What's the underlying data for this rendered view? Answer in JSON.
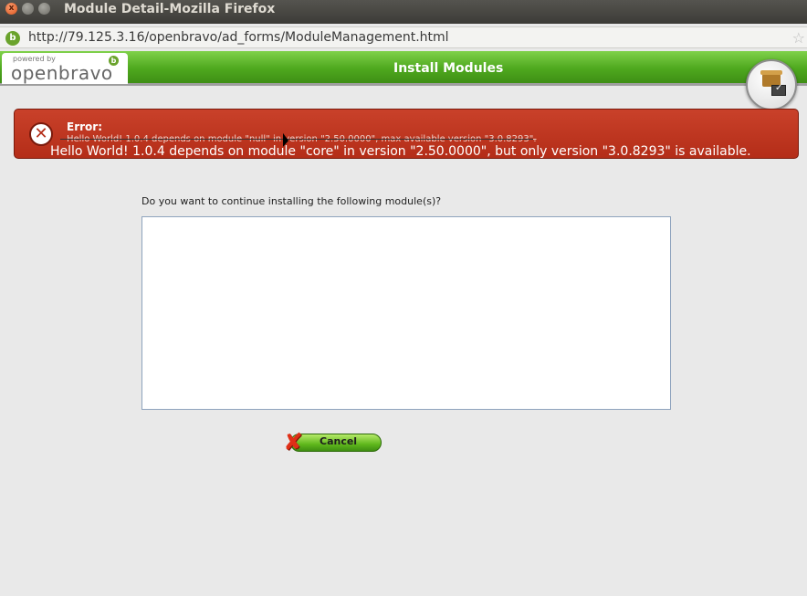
{
  "window": {
    "title": "Module Detail-Mozilla Firefox",
    "close_glyph": "x"
  },
  "browser": {
    "url": "http://79.125.3.16/openbravo/ad_forms/ModuleManagement.html",
    "site_icon_glyph": "b"
  },
  "header": {
    "logo_powered_by": "powered by",
    "logo_name": "openbravo",
    "logo_icon_glyph": "b",
    "page_title": "Install Modules",
    "module_icon": "module-package-icon"
  },
  "error": {
    "title": "Error:",
    "original_message": "Hello World! 1.0.4 depends on module \"null\" in version \"2.50.0000\", max available version \"3.0.8293\".",
    "message": "Hello World! 1.0.4 depends on module \"core\" in version \"2.50.0000\", but only version \"3.0.8293\" is available.",
    "icon_glyph": "✕",
    "colors": {
      "background": "#b42d18",
      "text": "#ffffff"
    }
  },
  "content": {
    "question": "Do you want to continue installing the following module(s)?",
    "modules": []
  },
  "actions": {
    "cancel_label": "Cancel",
    "cancel_icon_glyph": "✘"
  },
  "colors": {
    "header_green": "#4ea81e",
    "list_border": "#8ea3bd"
  }
}
